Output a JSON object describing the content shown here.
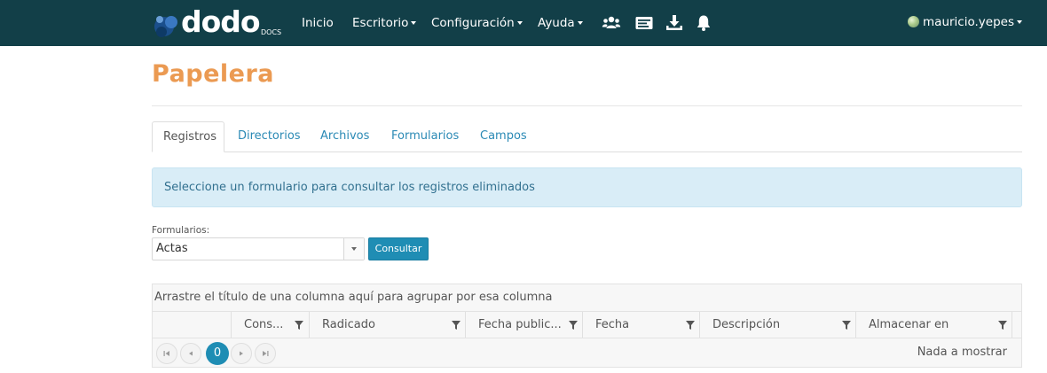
{
  "app": {
    "logo_text": "dodo",
    "logo_sub": "DOCS"
  },
  "nav": {
    "items": [
      {
        "label": "Inicio"
      },
      {
        "label": "Escritorio"
      },
      {
        "label": "Configuración"
      },
      {
        "label": "Ayuda"
      }
    ],
    "icons": [
      "users-icon",
      "id-card-icon",
      "download-icon",
      "bell-icon"
    ],
    "user": "mauricio.yepes"
  },
  "page": {
    "title": "Papelera"
  },
  "tabs": [
    {
      "label": "Registros",
      "active": true
    },
    {
      "label": "Directorios",
      "active": false
    },
    {
      "label": "Archivos",
      "active": false
    },
    {
      "label": "Formularios",
      "active": false
    },
    {
      "label": "Campos",
      "active": false
    }
  ],
  "alert": {
    "message": "Seleccione un formulario para consultar los registros eliminados"
  },
  "form": {
    "label": "Formularios:",
    "selected": "Actas",
    "button": "Consultar"
  },
  "grid": {
    "group_hint": "Arrastre el título de una columna aquí para agrupar por esa columna",
    "columns": [
      "Cons...",
      "Radicado",
      "Fecha public...",
      "Fecha",
      "Descripción",
      "Almacenar en"
    ],
    "pager": {
      "current_page": "0",
      "info": "Nada a mostrar"
    }
  },
  "colors": {
    "navbar": "#123f48",
    "title": "#eb9a52",
    "accent": "#1f8db4",
    "alert_bg": "#d9edf7",
    "alert_text": "#31708f"
  }
}
